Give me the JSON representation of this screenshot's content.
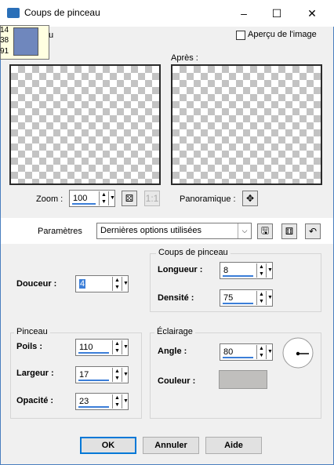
{
  "window": {
    "title": "Coups de pinceau",
    "minimize": "–",
    "maximize": "☐",
    "close": "✕"
  },
  "color_tooltip": {
    "lines": [
      "14",
      "38",
      "91"
    ],
    "swatch_color": "#6f87bd",
    "partial_label": "u"
  },
  "preview": {
    "checkbox_label": "Aperçu de l'image",
    "after_label": "Après :"
  },
  "zoom": {
    "label": "Zoom :",
    "value": "100"
  },
  "pan": {
    "label": "Panoramique :"
  },
  "params": {
    "label": "Paramètres",
    "selected": "Dernières options utilisées"
  },
  "softness": {
    "label": "Douceur :",
    "value": "4"
  },
  "stroke": {
    "group_label": "Coups de pinceau",
    "length_label": "Longueur :",
    "length_value": "8",
    "density_label": "Densité :",
    "density_value": "75"
  },
  "brush": {
    "group_label": "Pinceau",
    "bristles_label": "Poils :",
    "bristles_value": "110",
    "width_label": "Largeur :",
    "width_value": "17",
    "opacity_label": "Opacité :",
    "opacity_value": "23"
  },
  "lighting": {
    "group_label": "Éclairage",
    "angle_label": "Angle :",
    "angle_value": "80",
    "color_label": "Couleur :",
    "color_value": "#c0bfbd"
  },
  "buttons": {
    "ok": "OK",
    "cancel": "Annuler",
    "help": "Aide"
  }
}
